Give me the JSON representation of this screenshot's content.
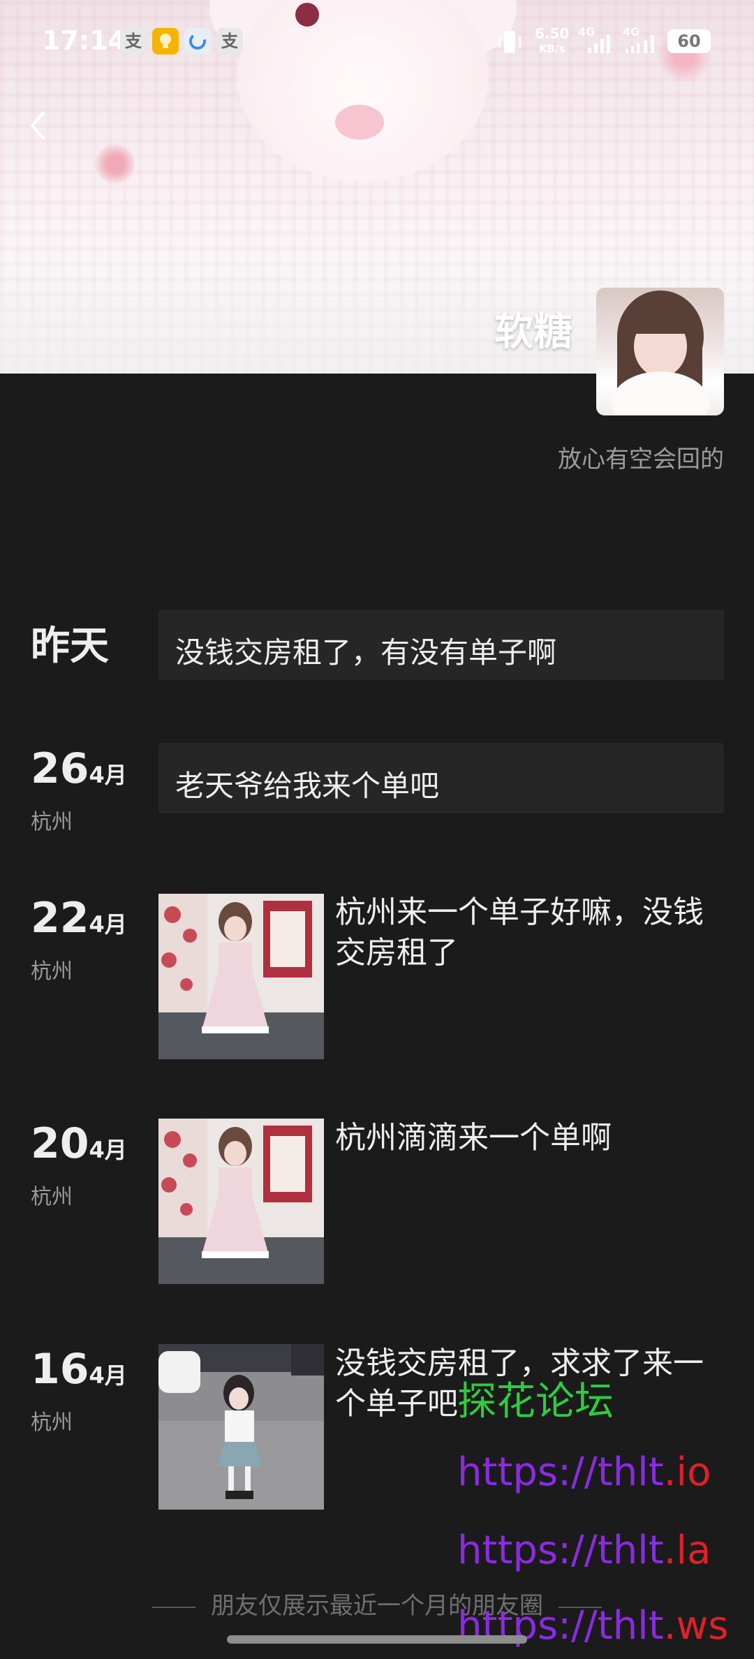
{
  "status_bar": {
    "time": "17:14",
    "app_icons": [
      "支",
      "",
      "",
      "支"
    ],
    "net_speed": "6.50",
    "net_unit": "KB/s",
    "net1": "4G",
    "net2": "4G",
    "battery": "60"
  },
  "profile": {
    "name": "软糖",
    "signature": "放心有空会回的"
  },
  "posts": [
    {
      "date": "昨天",
      "text": "没钱交房租了，有没有单子啊"
    },
    {
      "day": "26",
      "month": "4月",
      "location": "杭州",
      "text": "老天爷给我来个单吧"
    },
    {
      "day": "22",
      "month": "4月",
      "location": "杭州",
      "text": "杭州来一个单子好嘛，没钱交房租了"
    },
    {
      "day": "20",
      "month": "4月",
      "location": "杭州",
      "text": "杭州滴滴来一个单啊"
    },
    {
      "day": "16",
      "month": "4月",
      "location": "杭州",
      "text": "没钱交房租了，求求了来一个单子吧"
    }
  ],
  "footer": {
    "note": "朋友仅展示最近一个月的朋友圈"
  },
  "watermark": {
    "title": "探花论坛",
    "urls": [
      {
        "prefix": "https://",
        "domain": "thlt",
        "tld": ".io"
      },
      {
        "prefix": "https://",
        "domain": "thlt",
        "tld": ".la"
      },
      {
        "prefix": "https://",
        "domain": "thlt",
        "tld": ".ws"
      }
    ],
    "colors": {
      "title": "#2ecc40",
      "prefix": "#8a2be2",
      "tld": "#e0202a"
    }
  }
}
